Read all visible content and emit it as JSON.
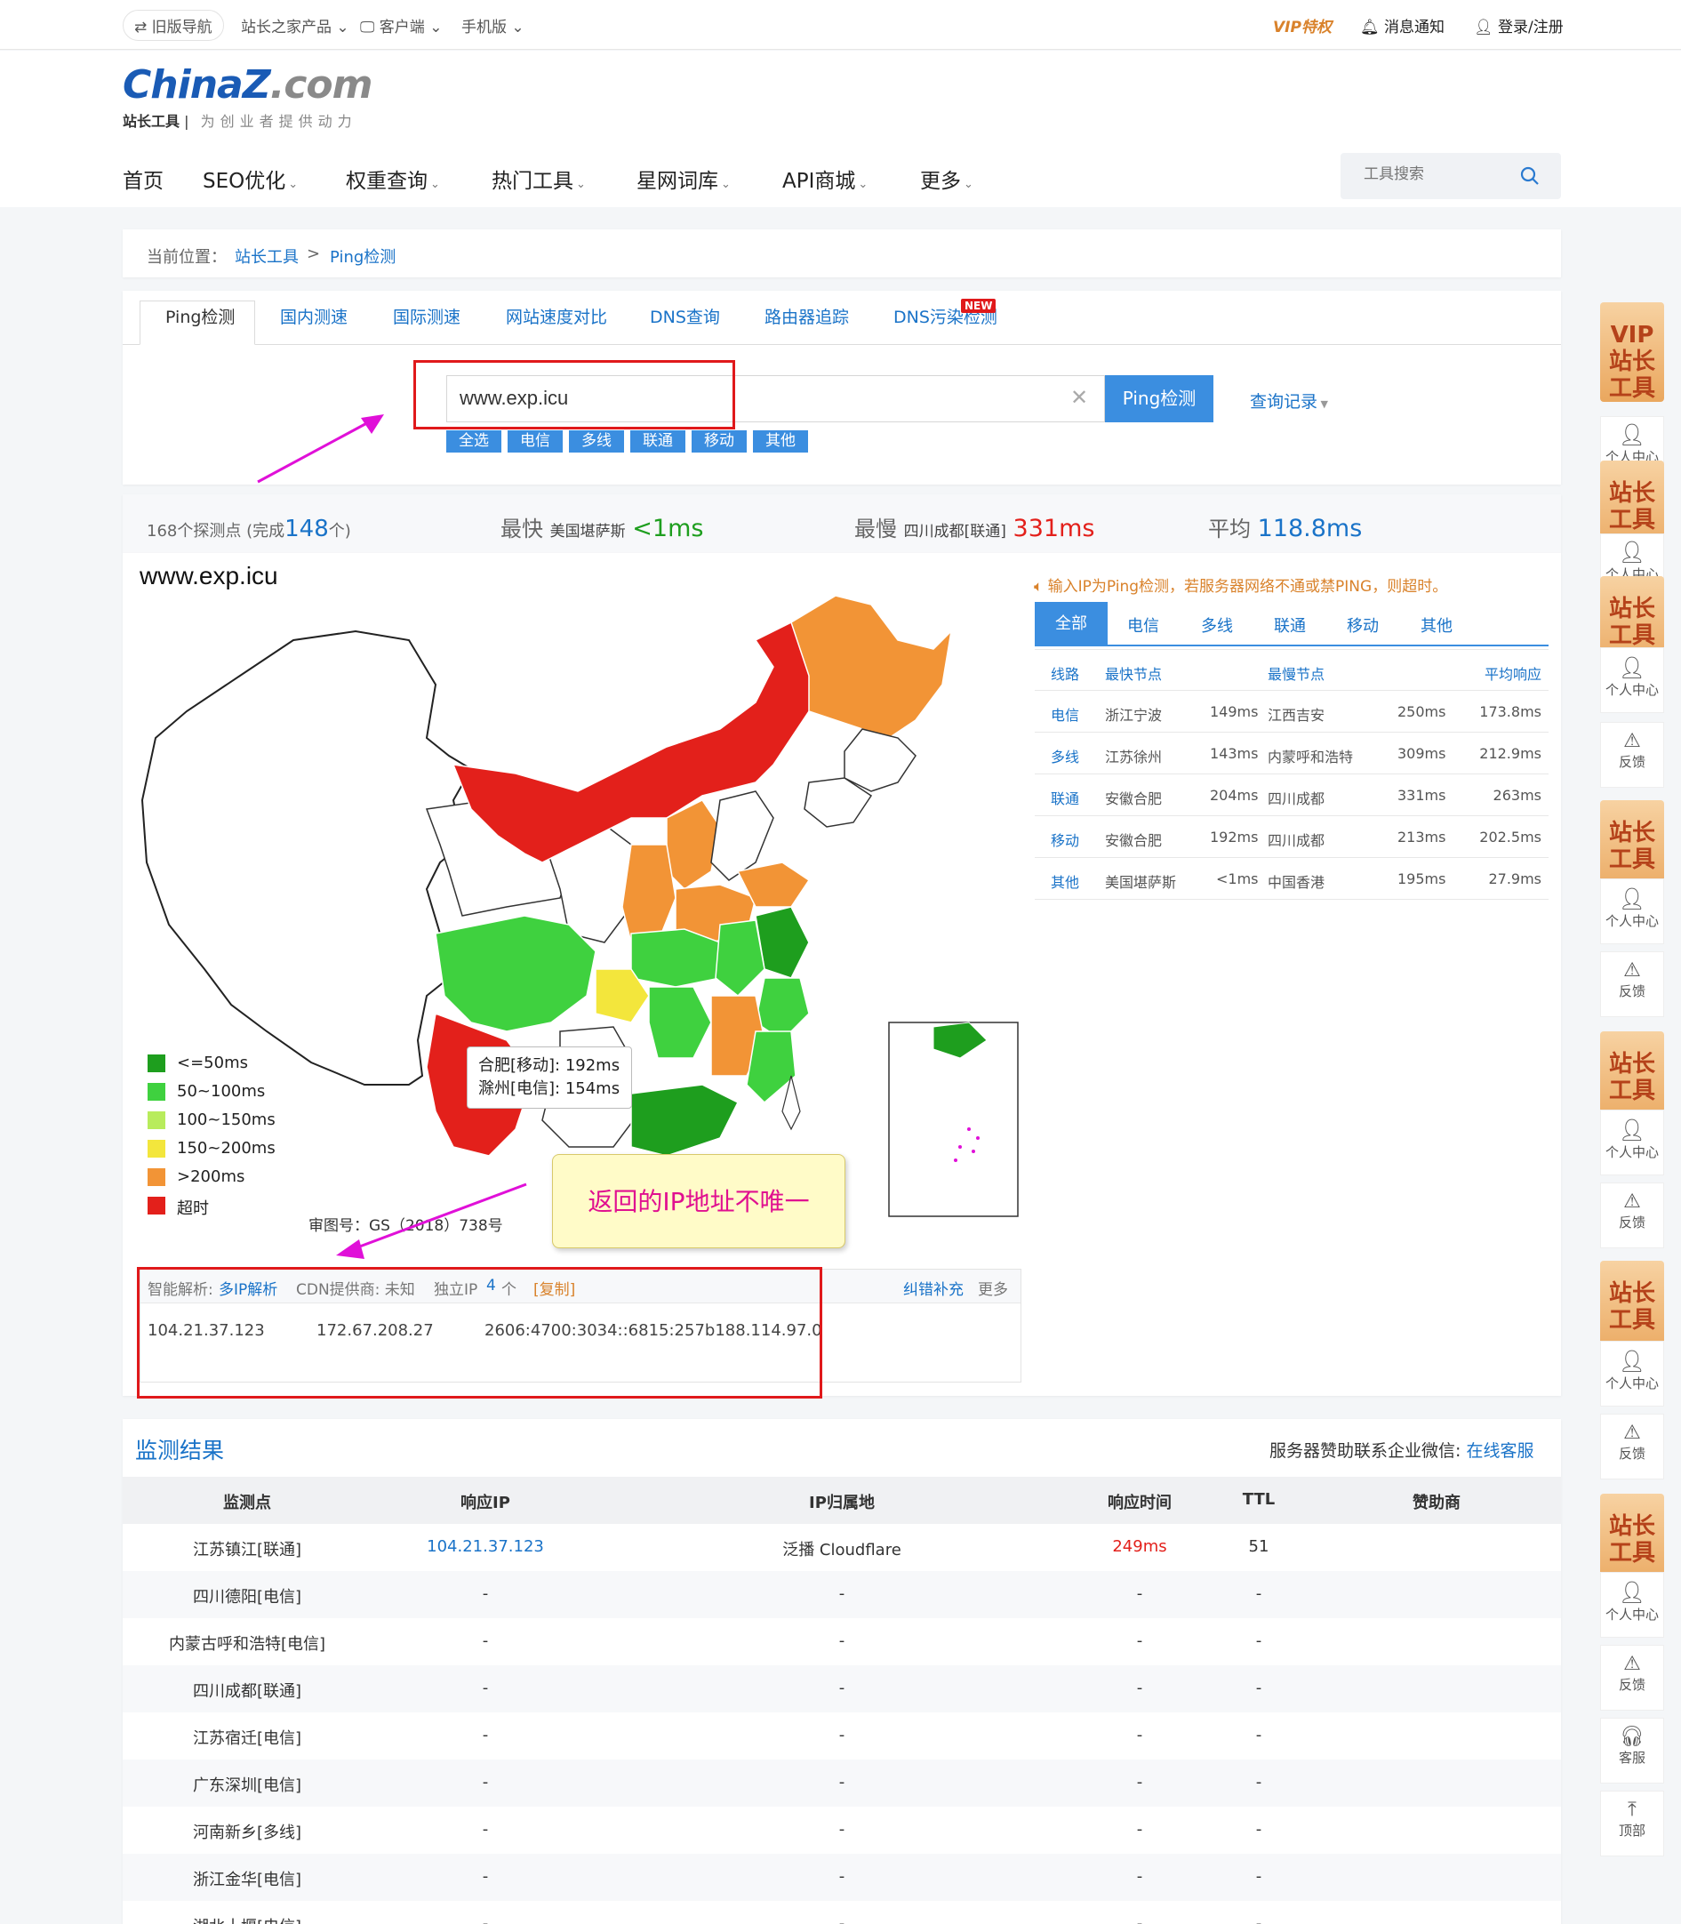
{
  "topbar": {
    "old_nav": "旧版导航",
    "products": "站长之家产品",
    "client": "客户端",
    "mobile": "手机版",
    "vip": "VIP特权",
    "notify": "消息通知",
    "login": "登录/注册"
  },
  "logo": {
    "main_a": "China",
    "main_z": "Z",
    "main_b": ".com",
    "sub_a": "站长工具",
    "sub_b": "为创业者提供动力"
  },
  "nav": [
    "首页",
    "SEO优化",
    "权重查询",
    "热门工具",
    "星网词库",
    "API商城",
    "更多"
  ],
  "tool_search_placeholder": "工具搜索",
  "breadcrumb": {
    "prefix": "当前位置：",
    "root": "站长工具",
    "sep": ">",
    "current": "Ping检测"
  },
  "tabs": [
    "Ping检测",
    "国内测速",
    "国际测速",
    "网站速度对比",
    "DNS查询",
    "路由器追踪",
    "DNS污染检测"
  ],
  "new_badge": "NEW",
  "url_input_value": "www.exp.icu",
  "ping_button": "Ping检测",
  "history": "查询记录",
  "filters": [
    "全选",
    "电信",
    "多线",
    "联通",
    "移动",
    "其他"
  ],
  "stats": {
    "probe_pre": "168个探测点 (完成",
    "probe_count": "148",
    "probe_post": "个)",
    "fastest_label": "最快",
    "fastest_loc": "美国堪萨斯",
    "fastest_val": "<1ms",
    "slowest_label": "最慢",
    "slowest_loc": "四川成都[联通]",
    "slowest_val": "331ms",
    "avg_label": "平均",
    "avg_val": "118.8ms"
  },
  "map_title": "www.exp.icu",
  "legend": [
    {
      "label": "<=50ms",
      "color": "#1e9e1e"
    },
    {
      "label": "50~100ms",
      "color": "#3fd13f"
    },
    {
      "label": "100~150ms",
      "color": "#b8ec5c"
    },
    {
      "label": "150~200ms",
      "color": "#f3e63c"
    },
    {
      "label": ">200ms",
      "color": "#f29436"
    },
    {
      "label": "超时",
      "color": "#e3201b"
    }
  ],
  "tooltip": {
    "line1": "合肥[移动]:  192ms",
    "line2": "滁州[电信]:  154ms"
  },
  "review_no": "审图号：GS（2018）738号",
  "annotation": "返回的IP地址不唯一",
  "hint": "输入IP为Ping检测，若服务器网络不通或禁PING，则超时。",
  "route_tabs": [
    "全部",
    "电信",
    "多线",
    "联通",
    "移动",
    "其他"
  ],
  "route_headers": [
    "线路",
    "最快节点",
    "最慢节点",
    "平均响应"
  ],
  "route_rows": [
    {
      "line": "电信",
      "fast": "浙江宁波",
      "fast_ms": "149ms",
      "slow": "江西吉安",
      "slow_ms": "250ms",
      "avg": "173.8ms"
    },
    {
      "line": "多线",
      "fast": "江苏徐州",
      "fast_ms": "143ms",
      "slow": "内蒙呼和浩特",
      "slow_ms": "309ms",
      "avg": "212.9ms"
    },
    {
      "line": "联通",
      "fast": "安徽合肥",
      "fast_ms": "204ms",
      "slow": "四川成都",
      "slow_ms": "331ms",
      "avg": "263ms"
    },
    {
      "line": "移动",
      "fast": "安徽合肥",
      "fast_ms": "192ms",
      "slow": "四川成都",
      "slow_ms": "213ms",
      "avg": "202.5ms"
    },
    {
      "line": "其他",
      "fast": "美国堪萨斯",
      "fast_ms": "<1ms",
      "slow": "中国香港",
      "slow_ms": "195ms",
      "avg": "27.9ms"
    }
  ],
  "ipbox": {
    "smart_label": "智能解析:",
    "smart_value": "多IP解析",
    "cdn": "CDN提供商: 未知",
    "unique_pre": "独立IP",
    "unique_count": "4",
    "unique_post": "个",
    "copy": "[复制]",
    "correct": "纠错补充",
    "more": "更多",
    "ips": [
      "104.21.37.123",
      "172.67.208.27",
      "2606:4700:3034::6815:257b188.114.97.0"
    ]
  },
  "results": {
    "title": "监测结果",
    "sponsor_label": "服务器赞助联系企业微信:",
    "sponsor_link": "在线客服",
    "headers": [
      "监测点",
      "响应IP",
      "IP归属地",
      "响应时间",
      "TTL",
      "赞助商"
    ],
    "rows": [
      {
        "node": "江苏镇江[联通]",
        "ip": "104.21.37.123",
        "loc": "泛播 Cloudflare",
        "time": "249ms",
        "ttl": "51"
      },
      {
        "node": "四川德阳[电信]",
        "ip": "-",
        "loc": "-",
        "time": "-",
        "ttl": "-"
      },
      {
        "node": "内蒙古呼和浩特[电信]",
        "ip": "-",
        "loc": "-",
        "time": "-",
        "ttl": "-"
      },
      {
        "node": "四川成都[联通]",
        "ip": "-",
        "loc": "-",
        "time": "-",
        "ttl": "-"
      },
      {
        "node": "江苏宿迁[电信]",
        "ip": "-",
        "loc": "-",
        "time": "-",
        "ttl": "-"
      },
      {
        "node": "广东深圳[电信]",
        "ip": "-",
        "loc": "-",
        "time": "-",
        "ttl": "-"
      },
      {
        "node": "河南新乡[多线]",
        "ip": "-",
        "loc": "-",
        "time": "-",
        "ttl": "-"
      },
      {
        "node": "浙江金华[电信]",
        "ip": "-",
        "loc": "-",
        "time": "-",
        "ttl": "-"
      },
      {
        "node": "湖北十堰[电信]",
        "ip": "-",
        "loc": "-",
        "time": "-",
        "ttl": "-"
      }
    ]
  },
  "sidebar": {
    "vip_badge": "VIP 站长 工具",
    "badge": "站长 工具",
    "personal": "个人中心",
    "feedback": "反馈",
    "service": "客服",
    "top": "顶部"
  },
  "colors": {
    "accent": "#1a73c8",
    "button": "#3b8ee0",
    "slow": "#e3201b",
    "fast": "#1e9e1e",
    "annotation": "#e01090"
  }
}
